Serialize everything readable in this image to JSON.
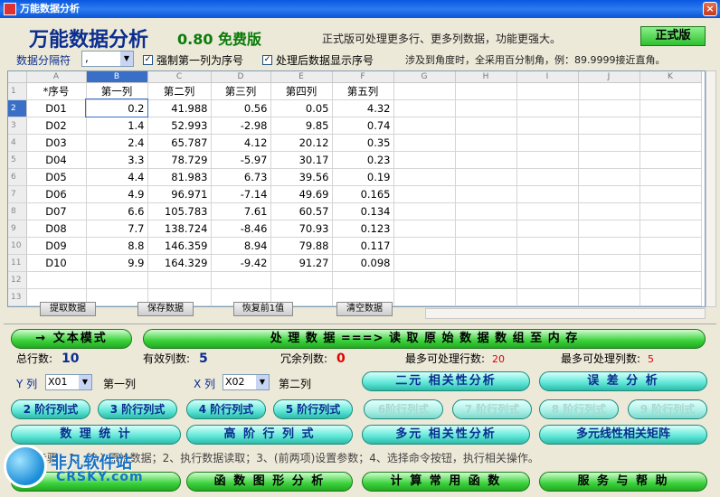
{
  "window": {
    "title": "万能数据分析",
    "close": "×"
  },
  "header": {
    "title": "万能数据分析",
    "version": "0.80 免费版",
    "promo": "正式版可处理更多行、更多列数据，功能更强大。",
    "pro_button": "正式版"
  },
  "options": {
    "separator_label": "数据分隔符",
    "separator_value": ",",
    "chk_first_col": "强制第一列为序号",
    "chk_show_index": "处理后数据显示序号",
    "angle_note": "涉及到角度时，全采用百分制角，例：89.9999接近直角。"
  },
  "grid": {
    "col_headers": [
      "A",
      "B",
      "C",
      "D",
      "E",
      "F",
      "G",
      "H",
      "I",
      "J",
      "K"
    ],
    "header_row": [
      "*序号",
      "第一列",
      "第二列",
      "第三列",
      "第四列",
      "第五列"
    ],
    "rows": [
      [
        "D01",
        "0.2",
        "41.988",
        "0.56",
        "0.05",
        "4.32"
      ],
      [
        "D02",
        "1.4",
        "52.993",
        "-2.98",
        "9.85",
        "0.74"
      ],
      [
        "D03",
        "2.4",
        "65.787",
        "4.12",
        "20.12",
        "0.35"
      ],
      [
        "D04",
        "3.3",
        "78.729",
        "-5.97",
        "30.17",
        "0.23"
      ],
      [
        "D05",
        "4.4",
        "81.983",
        "6.73",
        "39.56",
        "0.19"
      ],
      [
        "D06",
        "4.9",
        "96.971",
        "-7.14",
        "49.69",
        "0.165"
      ],
      [
        "D07",
        "6.6",
        "105.783",
        "7.61",
        "60.57",
        "0.134"
      ],
      [
        "D08",
        "7.7",
        "138.724",
        "-8.46",
        "70.93",
        "0.123"
      ],
      [
        "D09",
        "8.8",
        "146.359",
        "8.94",
        "79.88",
        "0.117"
      ],
      [
        "D10",
        "9.9",
        "164.329",
        "-9.42",
        "91.27",
        "0.098"
      ]
    ],
    "row_numbers": [
      "1",
      "2",
      "3",
      "4",
      "5",
      "6",
      "7",
      "8",
      "9",
      "10",
      "11",
      "12",
      "13"
    ]
  },
  "grid_buttons": {
    "extract": "提取数据",
    "save": "保存数据",
    "restore": "恢复前1值",
    "clear": "清空数据"
  },
  "process": {
    "text_mode": "→ 文本模式",
    "read_data": "处 理 数 据 ===> 读 取 原 始 数 据 数 组 至 内 存"
  },
  "stats": {
    "total_rows_label": "总行数:",
    "total_rows": "10",
    "valid_cols_label": "有效列数:",
    "valid_cols": "5",
    "redundant_cols_label": "冗余列数:",
    "redundant_cols": "0",
    "max_rows_label": "最多可处理行数:",
    "max_rows": "20",
    "max_cols_label": "最多可处理列数:",
    "max_cols": "5"
  },
  "selectors": {
    "y_label": "Y 列",
    "y_value": "X01",
    "y_name": "第一列",
    "x_label": "X 列",
    "x_value": "X02",
    "x_name": "第二列"
  },
  "analysis": {
    "bivariate": "二元 相关性分析",
    "error": "误 差 分 析",
    "order2": "2 阶行列式",
    "order3": "3 阶行列式",
    "order4": "4 阶行列式",
    "order5": "5 阶行列式",
    "order6": "6阶行列式",
    "order7": "7 阶行列式",
    "order8": "8 阶行列式",
    "order9": "9 阶行列式",
    "stats": "数 理 统 计",
    "high_order": "高 阶 行 列 式",
    "multi_corr": "多元 相关性分析",
    "multi_linear": "多元线性相关矩阵",
    "func_graph": "函 数 图 形 分 析",
    "calc_func": "计 算 常 用 函 数",
    "service": "服 务 与 帮 助"
  },
  "steps": "步骤：1、输入原始数据；2、执行数据读取；3、(前两项)设置参数；4、选择命令按钮，执行相关操作。",
  "watermark": {
    "name": "非凡软件站",
    "domain": "CRSKY.com"
  }
}
